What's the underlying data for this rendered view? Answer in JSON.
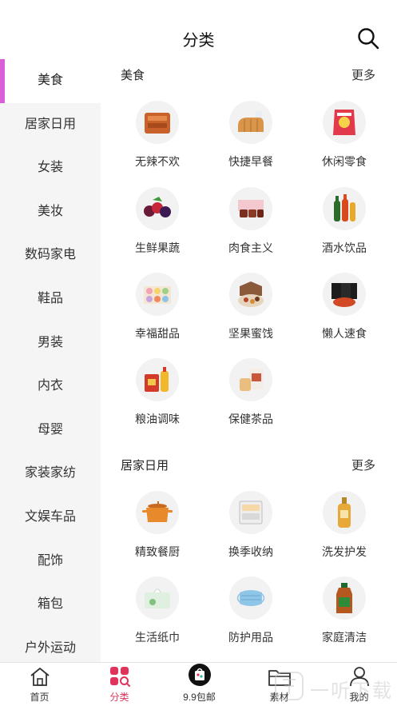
{
  "header": {
    "title": "分类",
    "search_icon": "search-icon"
  },
  "sidebar": {
    "items": [
      {
        "label": "美食"
      },
      {
        "label": "居家日用"
      },
      {
        "label": "女装"
      },
      {
        "label": "美妆"
      },
      {
        "label": "数码家电"
      },
      {
        "label": "鞋品"
      },
      {
        "label": "男装"
      },
      {
        "label": "内衣"
      },
      {
        "label": "母婴"
      },
      {
        "label": "家装家纺"
      },
      {
        "label": "文娱车品"
      },
      {
        "label": "配饰"
      },
      {
        "label": "箱包"
      },
      {
        "label": "户外运动"
      }
    ],
    "active_color": "#d95fd8"
  },
  "sections": [
    {
      "title": "美食",
      "more": "更多",
      "items": [
        {
          "label": "无辣不欢",
          "icon": "meat-snack-icon"
        },
        {
          "label": "快捷早餐",
          "icon": "bread-icon"
        },
        {
          "label": "休闲零食",
          "icon": "chips-icon"
        },
        {
          "label": "生鲜果蔬",
          "icon": "berries-icon"
        },
        {
          "label": "肉食主义",
          "icon": "meat-box-icon"
        },
        {
          "label": "酒水饮品",
          "icon": "bottles-icon"
        },
        {
          "label": "幸福甜品",
          "icon": "macaron-icon"
        },
        {
          "label": "坚果蜜饯",
          "icon": "nuts-icon"
        },
        {
          "label": "懒人速食",
          "icon": "instant-noodle-icon"
        },
        {
          "label": "粮油调味",
          "icon": "oil-rice-icon"
        },
        {
          "label": "保健茶品",
          "icon": "tea-icon"
        }
      ]
    },
    {
      "title": "居家日用",
      "more": "更多",
      "items": [
        {
          "label": "精致餐厨",
          "icon": "pot-icon"
        },
        {
          "label": "换季收纳",
          "icon": "storage-drawer-icon"
        },
        {
          "label": "洗发护发",
          "icon": "shampoo-icon"
        },
        {
          "label": "生活纸巾",
          "icon": "tissue-icon"
        },
        {
          "label": "防护用品",
          "icon": "mask-icon"
        },
        {
          "label": "家庭清洁",
          "icon": "disinfectant-icon"
        }
      ]
    }
  ],
  "tabbar": {
    "items": [
      {
        "label": "首页",
        "icon": "home-icon"
      },
      {
        "label": "分类",
        "icon": "category-icon"
      },
      {
        "label": "9.9包邮",
        "icon": "bag-icon"
      },
      {
        "label": "素材",
        "icon": "folder-icon"
      },
      {
        "label": "我的",
        "icon": "user-icon"
      }
    ],
    "active_color": "#e0335b"
  }
}
